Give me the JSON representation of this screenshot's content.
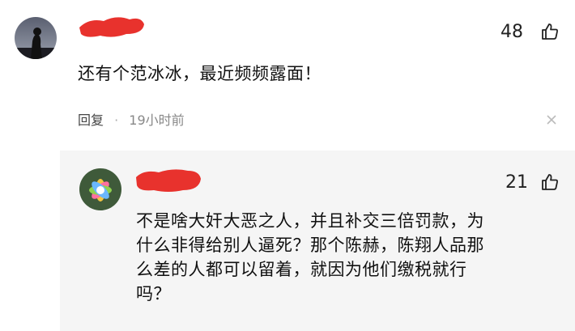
{
  "comment": {
    "likes": "48",
    "text": "还有个范冰冰，最近频频露面！",
    "reply_label": "回复",
    "separator": "·",
    "time": "19小时前",
    "like_icon": "thumbs-up-icon",
    "close_icon": "close-icon"
  },
  "reply": {
    "likes": "21",
    "text_lines": [
      "不是啥大奸大恶之人，并且补交三倍罚款，为",
      "什么非得给别人逼死？那个陈赫，陈翔人品那",
      "么差的人都可以留着，就因为他们缴税就行",
      "吗？"
    ],
    "like_icon": "thumbs-up-icon"
  },
  "colors": {
    "redaction": "#e8322d",
    "reply_background": "#f5f5f5"
  }
}
